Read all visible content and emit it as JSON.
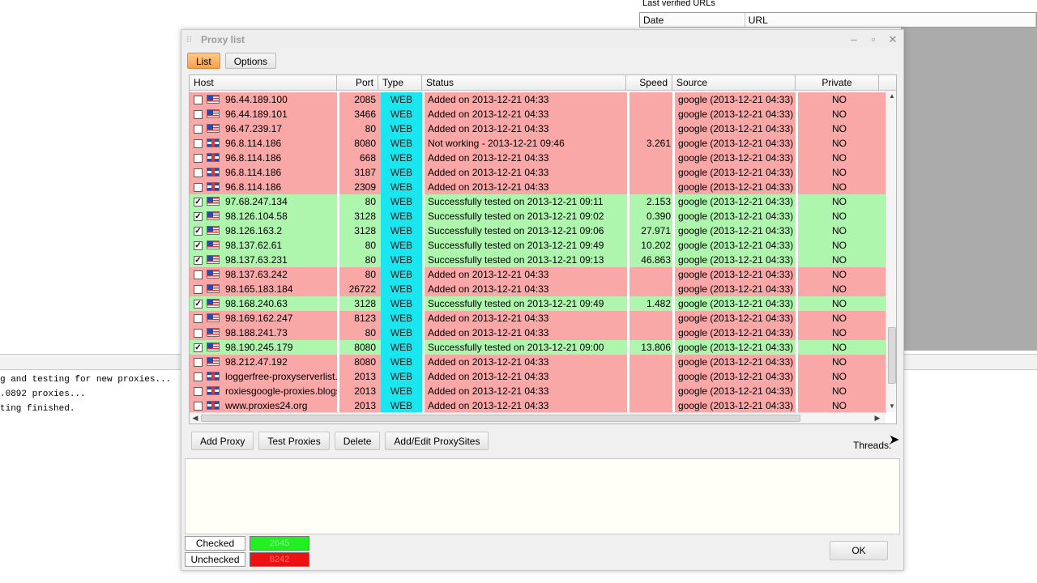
{
  "background": {
    "urls_label": "Last verified URLs",
    "url_columns": [
      "Date",
      "URL"
    ],
    "log_lines": [
      "g and testing for new proxies...",
      ".0892 proxies...",
      "ting finished."
    ]
  },
  "dialog": {
    "title": "Proxy list",
    "tabs": [
      {
        "label": "List",
        "active": true
      },
      {
        "label": "Options",
        "active": false
      }
    ],
    "columns": [
      "Host",
      "Port",
      "Type",
      "Status",
      "Speed",
      "Source",
      "Private"
    ],
    "rows": [
      {
        "checked": false,
        "flag": "us",
        "host": "96.44.189.100",
        "port": "2085",
        "type": "WEB",
        "status": "Added on 2013-12-21 04:33",
        "speed": "",
        "source": "google (2013-12-21 04:33)",
        "private": "NO"
      },
      {
        "checked": false,
        "flag": "us",
        "host": "96.44.189.101",
        "port": "3466",
        "type": "WEB",
        "status": "Added on 2013-12-21 04:33",
        "speed": "",
        "source": "google (2013-12-21 04:33)",
        "private": "NO"
      },
      {
        "checked": false,
        "flag": "us",
        "host": "96.47.239.17",
        "port": "80",
        "type": "WEB",
        "status": "Added on 2013-12-21 04:33",
        "speed": "",
        "source": "google (2013-12-21 04:33)",
        "private": "NO"
      },
      {
        "checked": false,
        "flag": "uk",
        "host": "96.8.114.186",
        "port": "8080",
        "type": "WEB",
        "status": "Not working - 2013-12-21 09:46",
        "speed": "3.261",
        "source": "google (2013-12-21 04:33)",
        "private": "NO"
      },
      {
        "checked": false,
        "flag": "uk",
        "host": "96.8.114.186",
        "port": "668",
        "type": "WEB",
        "status": "Added on 2013-12-21 04:33",
        "speed": "",
        "source": "google (2013-12-21 04:33)",
        "private": "NO"
      },
      {
        "checked": false,
        "flag": "uk",
        "host": "96.8.114.186",
        "port": "3187",
        "type": "WEB",
        "status": "Added on 2013-12-21 04:33",
        "speed": "",
        "source": "google (2013-12-21 04:33)",
        "private": "NO"
      },
      {
        "checked": false,
        "flag": "uk",
        "host": "96.8.114.186",
        "port": "2309",
        "type": "WEB",
        "status": "Added on 2013-12-21 04:33",
        "speed": "",
        "source": "google (2013-12-21 04:33)",
        "private": "NO"
      },
      {
        "checked": true,
        "flag": "us",
        "host": "97.68.247.134",
        "port": "80",
        "type": "WEB",
        "status": "Successfully tested on 2013-12-21 09:11",
        "speed": "2.153",
        "source": "google (2013-12-21 04:33)",
        "private": "NO"
      },
      {
        "checked": true,
        "flag": "us",
        "host": "98.126.104.58",
        "port": "3128",
        "type": "WEB",
        "status": "Successfully tested on 2013-12-21 09:02",
        "speed": "0.390",
        "source": "google (2013-12-21 04:33)",
        "private": "NO"
      },
      {
        "checked": true,
        "flag": "us",
        "host": "98.126.163.2",
        "port": "3128",
        "type": "WEB",
        "status": "Successfully tested on 2013-12-21 09:06",
        "speed": "27.971",
        "source": "google (2013-12-21 04:33)",
        "private": "NO"
      },
      {
        "checked": true,
        "flag": "us",
        "host": "98.137.62.61",
        "port": "80",
        "type": "WEB",
        "status": "Successfully tested on 2013-12-21 09:49",
        "speed": "10.202",
        "source": "google (2013-12-21 04:33)",
        "private": "NO"
      },
      {
        "checked": true,
        "flag": "us",
        "host": "98.137.63.231",
        "port": "80",
        "type": "WEB",
        "status": "Successfully tested on 2013-12-21 09:13",
        "speed": "46.863",
        "source": "google (2013-12-21 04:33)",
        "private": "NO"
      },
      {
        "checked": false,
        "flag": "us",
        "host": "98.137.63.242",
        "port": "80",
        "type": "WEB",
        "status": "Added on 2013-12-21 04:33",
        "speed": "",
        "source": "google (2013-12-21 04:33)",
        "private": "NO"
      },
      {
        "checked": false,
        "flag": "us",
        "host": "98.165.183.184",
        "port": "26722",
        "type": "WEB",
        "status": "Added on 2013-12-21 04:33",
        "speed": "",
        "source": "google (2013-12-21 04:33)",
        "private": "NO"
      },
      {
        "checked": true,
        "flag": "us",
        "host": "98.168.240.63",
        "port": "3128",
        "type": "WEB",
        "status": "Successfully tested on 2013-12-21 09:49",
        "speed": "1.482",
        "source": "google (2013-12-21 04:33)",
        "private": "NO"
      },
      {
        "checked": false,
        "flag": "us",
        "host": "98.169.162.247",
        "port": "8123",
        "type": "WEB",
        "status": "Added on 2013-12-21 04:33",
        "speed": "",
        "source": "google (2013-12-21 04:33)",
        "private": "NO"
      },
      {
        "checked": false,
        "flag": "us",
        "host": "98.188.241.73",
        "port": "80",
        "type": "WEB",
        "status": "Added on 2013-12-21 04:33",
        "speed": "",
        "source": "google (2013-12-21 04:33)",
        "private": "NO"
      },
      {
        "checked": true,
        "flag": "us",
        "host": "98.190.245.179",
        "port": "8080",
        "type": "WEB",
        "status": "Successfully tested on 2013-12-21 09:00",
        "speed": "13.806",
        "source": "google (2013-12-21 04:33)",
        "private": "NO"
      },
      {
        "checked": false,
        "flag": "us",
        "host": "98.212.47.192",
        "port": "8080",
        "type": "WEB",
        "status": "Added on 2013-12-21 04:33",
        "speed": "",
        "source": "google (2013-12-21 04:33)",
        "private": "NO"
      },
      {
        "checked": false,
        "flag": "uk",
        "host": "loggerfree-proxyserverlist.b...",
        "port": "2013",
        "type": "WEB",
        "status": "Added on 2013-12-21 04:33",
        "speed": "",
        "source": "google (2013-12-21 04:33)",
        "private": "NO"
      },
      {
        "checked": false,
        "flag": "uk",
        "host": "roxiesgoogle-proxies.blogs...",
        "port": "2013",
        "type": "WEB",
        "status": "Added on 2013-12-21 04:33",
        "speed": "",
        "source": "google (2013-12-21 04:33)",
        "private": "NO"
      },
      {
        "checked": false,
        "flag": "uk",
        "host": "www.proxies24.org",
        "port": "2013",
        "type": "WEB",
        "status": "Added on 2013-12-21 04:33",
        "speed": "",
        "source": "google (2013-12-21 04:33)",
        "private": "NO"
      }
    ],
    "buttons": [
      "Add Proxy",
      "Test Proxies",
      "Delete",
      "Add/Edit ProxySites"
    ],
    "threads_label": "Threads:",
    "stats": [
      {
        "label": "Checked",
        "value": "2645",
        "color": "#22ee22"
      },
      {
        "label": "Unchecked",
        "value": "8242",
        "color": "#ee1111"
      }
    ],
    "ok_label": "OK"
  },
  "colors": {
    "row_bad": "#f9a7a7",
    "row_good": "#aef5ae",
    "type_cell": "#19e6ef",
    "tab_active": "#f5a04a"
  }
}
